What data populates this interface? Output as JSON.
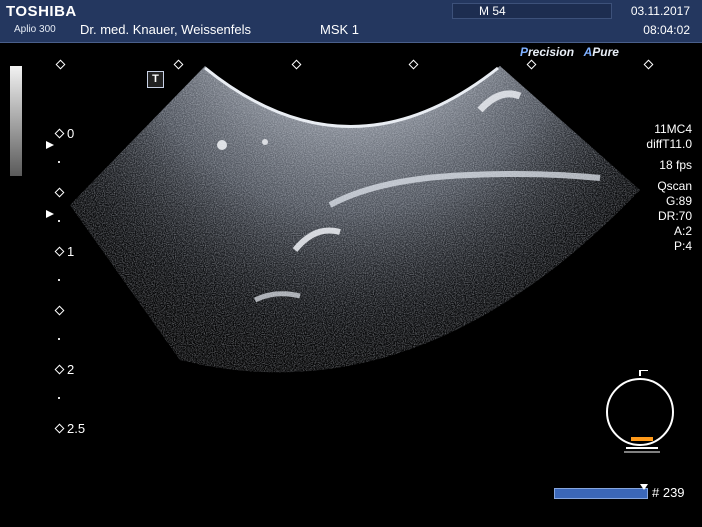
{
  "header": {
    "brand": "TOSHIBA",
    "model": "Aplio 300",
    "hospital": "Dr. med. Knauer, Weissenfels",
    "preset": "MSK 1",
    "mi": "M 54",
    "date": "03.11.2017",
    "time": "08:04:02"
  },
  "modes": {
    "precision_initial": "P",
    "precision_rest": "recision",
    "apure_initial": "A",
    "apure_rest": "Pure"
  },
  "image": {
    "badge": "T"
  },
  "depth_scale": {
    "labels": [
      "0",
      "1",
      "2",
      "2.5"
    ]
  },
  "params": {
    "probe": "11MC4",
    "freq": "diffT11.0",
    "fps": "18 fps",
    "scan": "Qscan",
    "gain": "G:89",
    "dr": "DR:70",
    "a": "A:2",
    "p": "P:4"
  },
  "cine": {
    "frame": "# 239"
  },
  "colors": {
    "header_bg": "#24375f",
    "accent": "#7fb0ff",
    "cine_bar": "#3b67b8",
    "probe_marker": "#ff9a1a"
  },
  "icons": [
    "grayscale-bar-icon",
    "focus-marker-icon",
    "probe-orientation-icon",
    "cine-cursor-icon"
  ]
}
